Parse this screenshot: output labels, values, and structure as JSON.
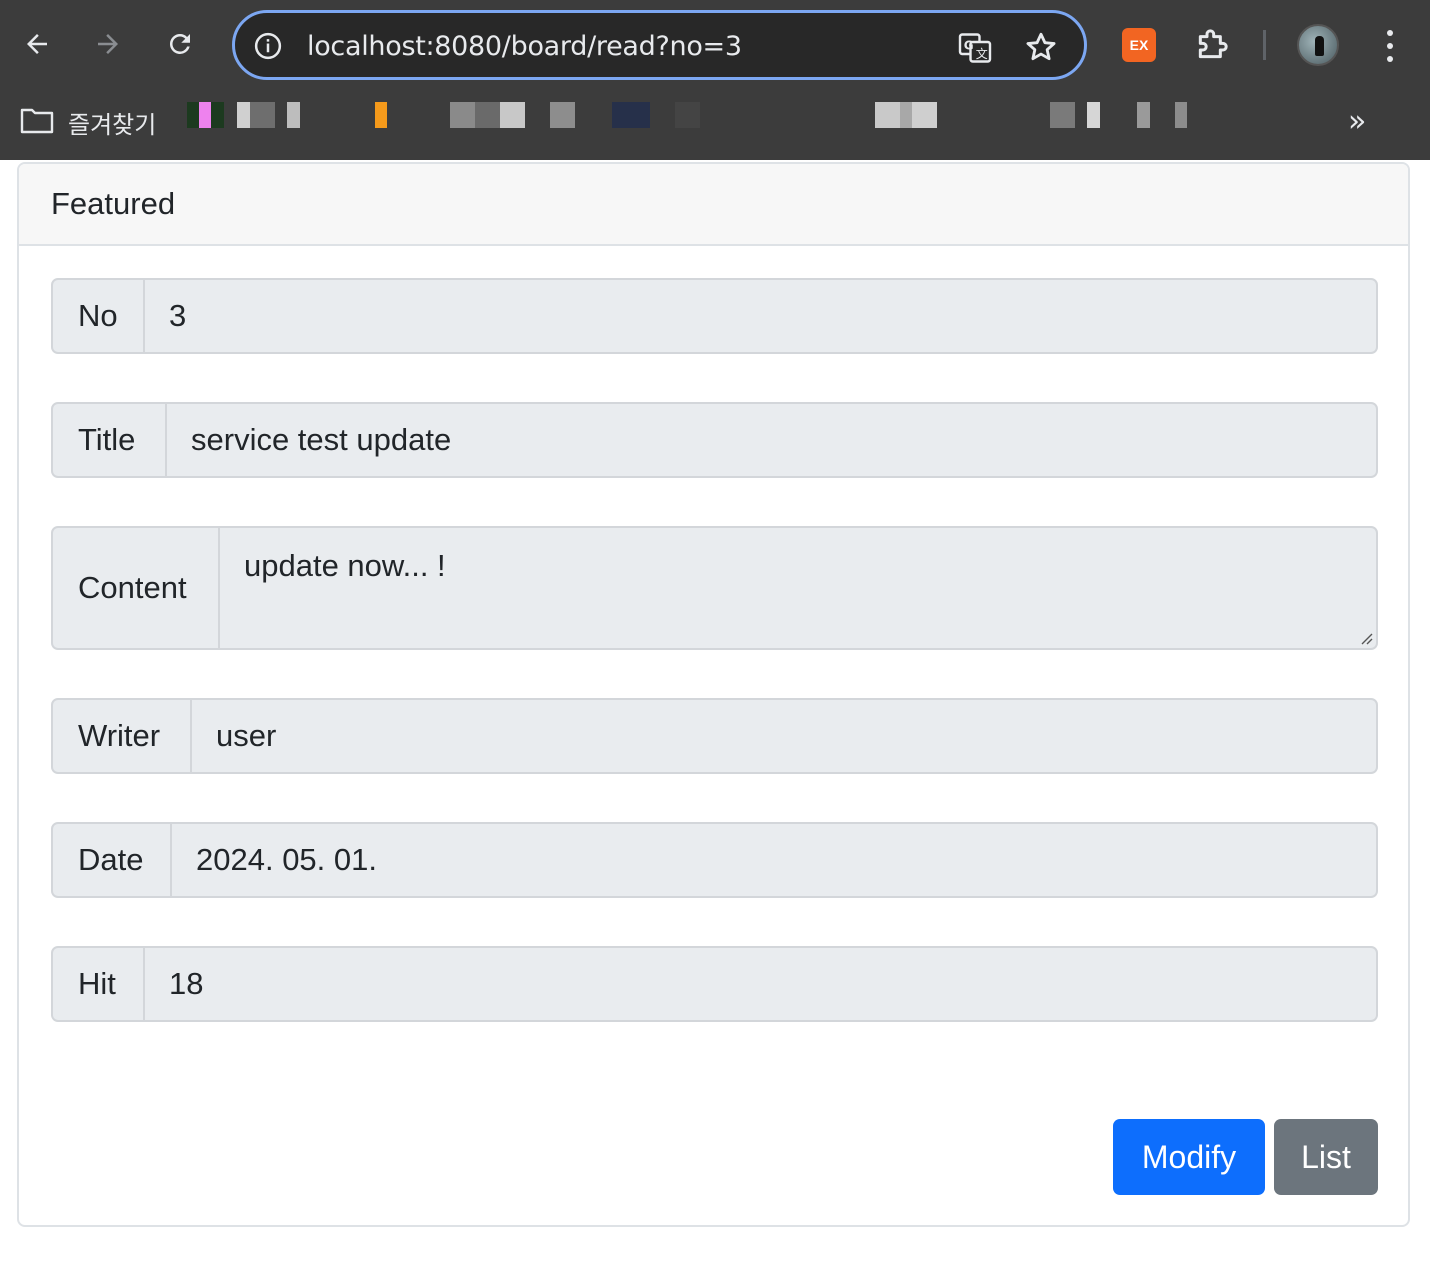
{
  "browser": {
    "url": "localhost:8080/board/read?no=3",
    "bookmarks_folder_label": "즐겨찾기",
    "extension_ex_label": "EX",
    "more_label": "»"
  },
  "card": {
    "header": "Featured",
    "fields": [
      {
        "label": "No",
        "value": "3"
      },
      {
        "label": "Title",
        "value": "service test update"
      },
      {
        "label": "Content",
        "value": "update now... !"
      },
      {
        "label": "Writer",
        "value": "user"
      },
      {
        "label": "Date",
        "value": "2024. 05. 01."
      },
      {
        "label": "Hit",
        "value": "18"
      }
    ],
    "buttons": {
      "modify": "Modify",
      "list": "List"
    }
  },
  "colors": {
    "primary": "#0d6efd",
    "secondary": "#6c757d",
    "field_bg": "#e9ecef",
    "chrome_bg": "#3c3c3c",
    "omnibox_focus": "#7ca7f2"
  },
  "icons": [
    "back-arrow-icon",
    "forward-arrow-icon",
    "reload-icon",
    "site-info-icon",
    "translate-icon",
    "star-icon",
    "extensions-puzzle-icon",
    "profile-avatar",
    "kebab-menu-icon",
    "folder-icon",
    "resize-grip-icon"
  ]
}
